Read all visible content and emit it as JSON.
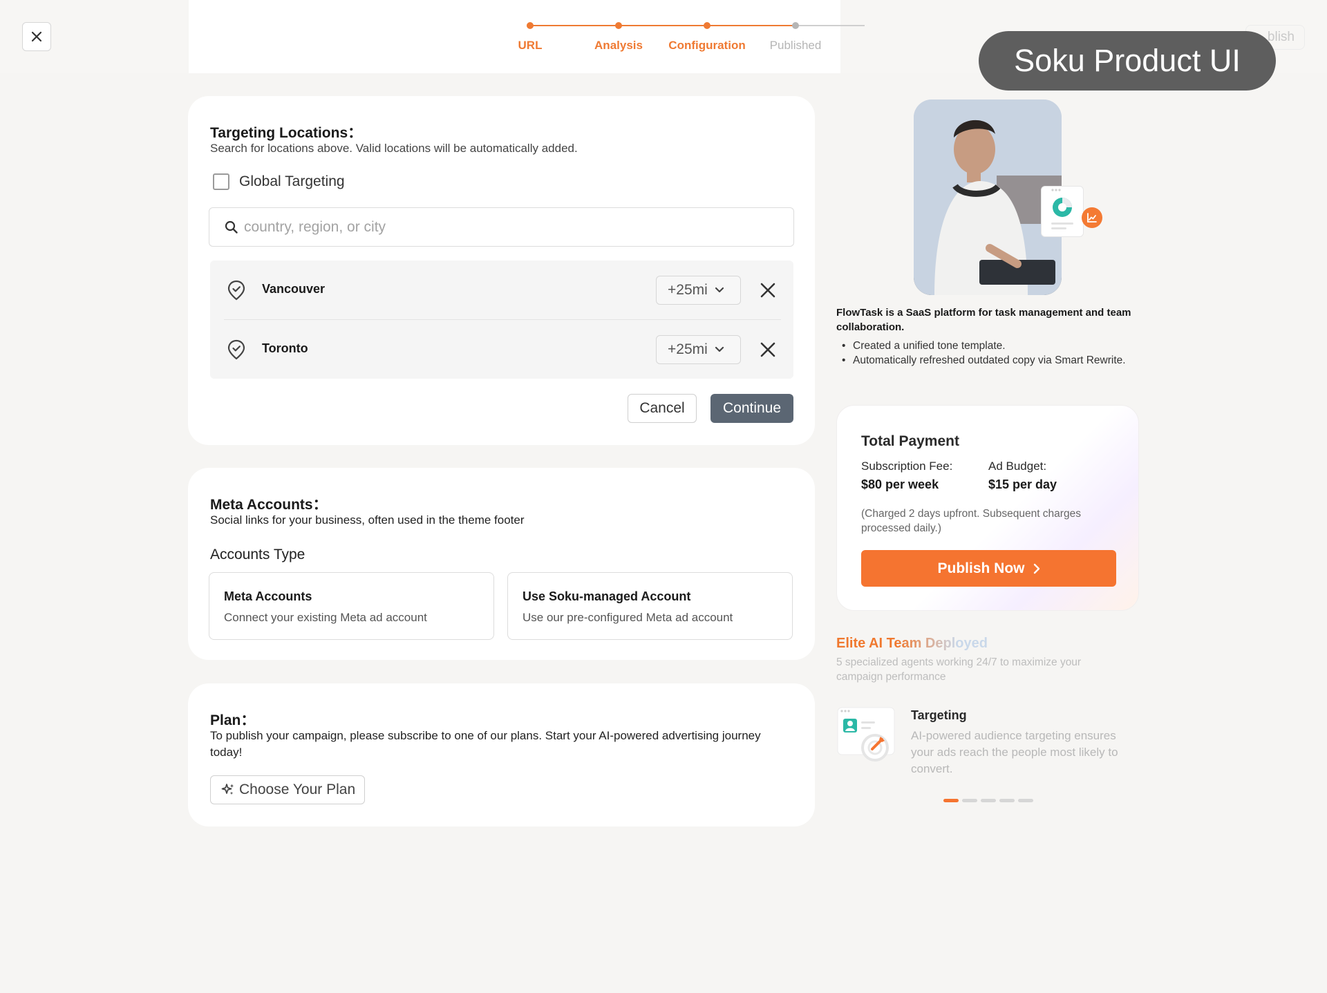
{
  "header": {
    "steps": [
      {
        "label": "URL",
        "state": "done"
      },
      {
        "label": "Analysis",
        "state": "done"
      },
      {
        "label": "Configuration",
        "state": "current"
      },
      {
        "label": "Published",
        "state": "pending"
      }
    ],
    "publish_ghost_label": "blish",
    "watermark": "Soku Product UI"
  },
  "targeting": {
    "title": "Targeting Locations：",
    "subtitle": "Search for locations above. Valid locations will be automatically added.",
    "global_label": "Global Targeting",
    "global_checked": false,
    "search_placeholder": "country, region, or city",
    "locations": [
      {
        "name": "Vancouver",
        "radius": "+25mi"
      },
      {
        "name": "Toronto",
        "radius": "+25mi"
      }
    ],
    "cancel_label": "Cancel",
    "continue_label": "Continue"
  },
  "meta": {
    "title": "Meta Accounts：",
    "subtitle": "Social links for your business, often used in the theme footer",
    "accounts_type_label": "Accounts Type",
    "options": [
      {
        "title": "Meta Accounts",
        "desc": "Connect your existing Meta ad account"
      },
      {
        "title": "Use Soku-managed Account",
        "desc": "Use our pre-configured Meta ad account"
      }
    ]
  },
  "plan": {
    "title": "Plan：",
    "desc": "To publish your campaign, please subscribe to one of our plans. Start your AI-powered advertising journey today!",
    "button_label": "Choose Your Plan"
  },
  "summary": {
    "lead": "FlowTask is a SaaS platform for task management and team collaboration.",
    "bullets": [
      "Created a unified tone template.",
      "Automatically refreshed outdated copy via Smart Rewrite."
    ]
  },
  "payment": {
    "title": "Total Payment",
    "subscription_label": "Subscription Fee:",
    "subscription_value": "$80 per week",
    "budget_label": "Ad Budget:",
    "budget_value": "$15 per day",
    "note": "(Charged 2 days upfront. Subsequent charges processed daily.)",
    "publish_label": "Publish Now"
  },
  "elite": {
    "title": "Elite AI Team Deployed",
    "subtitle": "5 specialized agents working 24/7 to maximize your campaign performance",
    "feature_title": "Targeting",
    "feature_desc": "AI-powered audience targeting ensures your ads reach the people most likely to convert.",
    "carousel_count": 5,
    "carousel_active": 0
  },
  "colors": {
    "accent": "#f57430",
    "step_done": "#ef7a33",
    "step_pending": "#b5b5b5",
    "continue_bg": "#5b6673"
  }
}
